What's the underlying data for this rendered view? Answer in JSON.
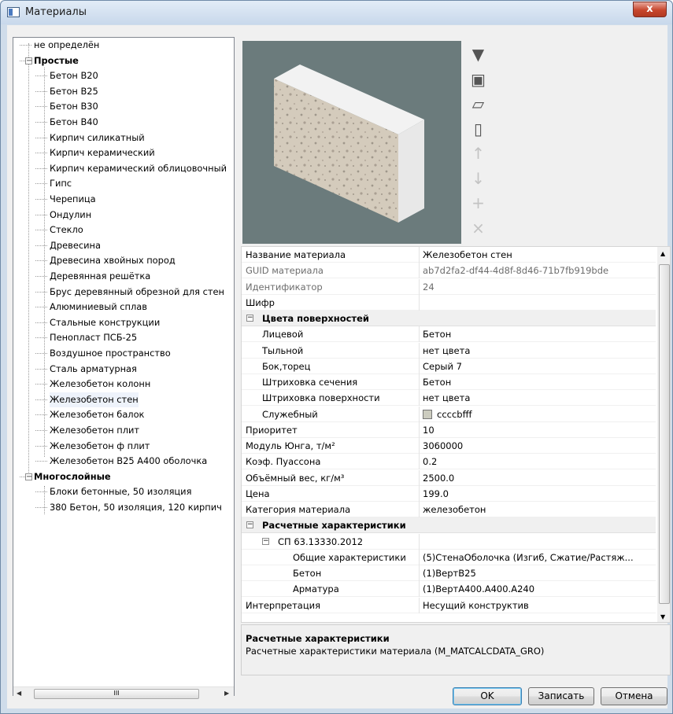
{
  "window": {
    "title": "Материалы",
    "close_label": "x"
  },
  "tree": {
    "items": [
      {
        "label": "не определён"
      },
      {
        "label": "Простые",
        "group": true,
        "expanded": true
      },
      {
        "label": "Бетон В20"
      },
      {
        "label": "Бетон В25"
      },
      {
        "label": "Бетон В30"
      },
      {
        "label": "Бетон В40"
      },
      {
        "label": "Кирпич силикатный"
      },
      {
        "label": "Кирпич керамический"
      },
      {
        "label": "Кирпич керамический облицовочный"
      },
      {
        "label": "Гипс"
      },
      {
        "label": "Черепица"
      },
      {
        "label": "Ондулин"
      },
      {
        "label": "Стекло"
      },
      {
        "label": "Древесина"
      },
      {
        "label": "Древесина хвойных пород"
      },
      {
        "label": "Деревянная решётка"
      },
      {
        "label": "Брус деревянный обрезной для стен"
      },
      {
        "label": "Алюминиевый сплав"
      },
      {
        "label": "Стальные конструкции"
      },
      {
        "label": "Пенопласт ПСБ-25"
      },
      {
        "label": "Воздушное пространство"
      },
      {
        "label": "Сталь арматурная"
      },
      {
        "label": "Железобетон колонн"
      },
      {
        "label": "Железобетон стен",
        "selected": true
      },
      {
        "label": "Железобетон балок"
      },
      {
        "label": "Железобетон плит"
      },
      {
        "label": "Железобетон ф плит"
      },
      {
        "label": "Железобетон В25 А400 оболочка"
      },
      {
        "label": "Многослойные",
        "group": true,
        "expanded": true
      },
      {
        "label": "Блоки бетонные, 50 изоляция"
      },
      {
        "label": "380 Бетон, 50 изоляция, 120 кирпич"
      }
    ],
    "scroll_thumb_label": "III"
  },
  "toolbar": {
    "icons": [
      {
        "name": "filter-icon",
        "glyph": "▼",
        "enabled": true
      },
      {
        "name": "wall-view-icon",
        "glyph": "▣",
        "enabled": true
      },
      {
        "name": "slab-view-icon",
        "glyph": "▱",
        "enabled": true
      },
      {
        "name": "column-view-icon",
        "glyph": "▯",
        "enabled": true
      },
      {
        "name": "move-up-icon",
        "glyph": "↑",
        "enabled": false
      },
      {
        "name": "move-down-icon",
        "glyph": "↓",
        "enabled": false
      },
      {
        "name": "add-icon",
        "glyph": "+",
        "enabled": false
      },
      {
        "name": "delete-icon",
        "glyph": "×",
        "enabled": false
      }
    ]
  },
  "properties": [
    {
      "key": "Название материала",
      "value": "Железобетон стен"
    },
    {
      "key": "GUID материала",
      "value": "ab7d2fa2-df44-4d8f-8d46-71b7fb919bde",
      "muted": true
    },
    {
      "key": "Идентификатор",
      "value": "24",
      "muted": true
    },
    {
      "key": "Шифр",
      "value": ""
    },
    {
      "key": "Цвета поверхностей",
      "value": "",
      "section": true,
      "level": 0
    },
    {
      "key": "Лицевой",
      "value": "Бетон",
      "level": 1
    },
    {
      "key": "Тыльной",
      "value": "нет цвета",
      "level": 1
    },
    {
      "key": "Бок,торец",
      "value": "Серый 7",
      "level": 1
    },
    {
      "key": "Штриховка сечения",
      "value": "Бетон",
      "level": 1
    },
    {
      "key": "Штриховка поверхности",
      "value": "нет цвета",
      "level": 1
    },
    {
      "key": "Служебный",
      "value": "ccccbfff",
      "level": 1,
      "swatch": "#ccccbf"
    },
    {
      "key": "Приоритет",
      "value": "10"
    },
    {
      "key": "Модуль Юнга, т/м²",
      "value": "3060000"
    },
    {
      "key": "Коэф. Пуассона",
      "value": "0.2"
    },
    {
      "key": "Объёмный вес, кг/м³",
      "value": "2500.0"
    },
    {
      "key": "Цена",
      "value": "199.0"
    },
    {
      "key": "Категория материала",
      "value": "железобетон"
    },
    {
      "key": "Расчетные характеристики",
      "value": "",
      "section": true,
      "level": 0
    },
    {
      "key": "СП 63.13330.2012",
      "value": "",
      "section": true,
      "level": 1,
      "plain": true
    },
    {
      "key": "Общие характеристики",
      "value": "(5)СтенаОболочка (Изгиб, Сжатие/Растяж...",
      "level": 2
    },
    {
      "key": "Бетон",
      "value": "(1)ВертВ25",
      "level": 2
    },
    {
      "key": "Арматура",
      "value": "(1)ВертА400.А400.А240",
      "level": 2
    },
    {
      "key": "Интерпретация",
      "value": "Несущий конструктив"
    }
  ],
  "description": {
    "title": "Расчетные характеристики",
    "text": "Расчетные характеристики материала (M_MATCALCDATA_GRO)"
  },
  "buttons": {
    "ok": "OK",
    "save": "Записать",
    "cancel": "Отмена"
  }
}
